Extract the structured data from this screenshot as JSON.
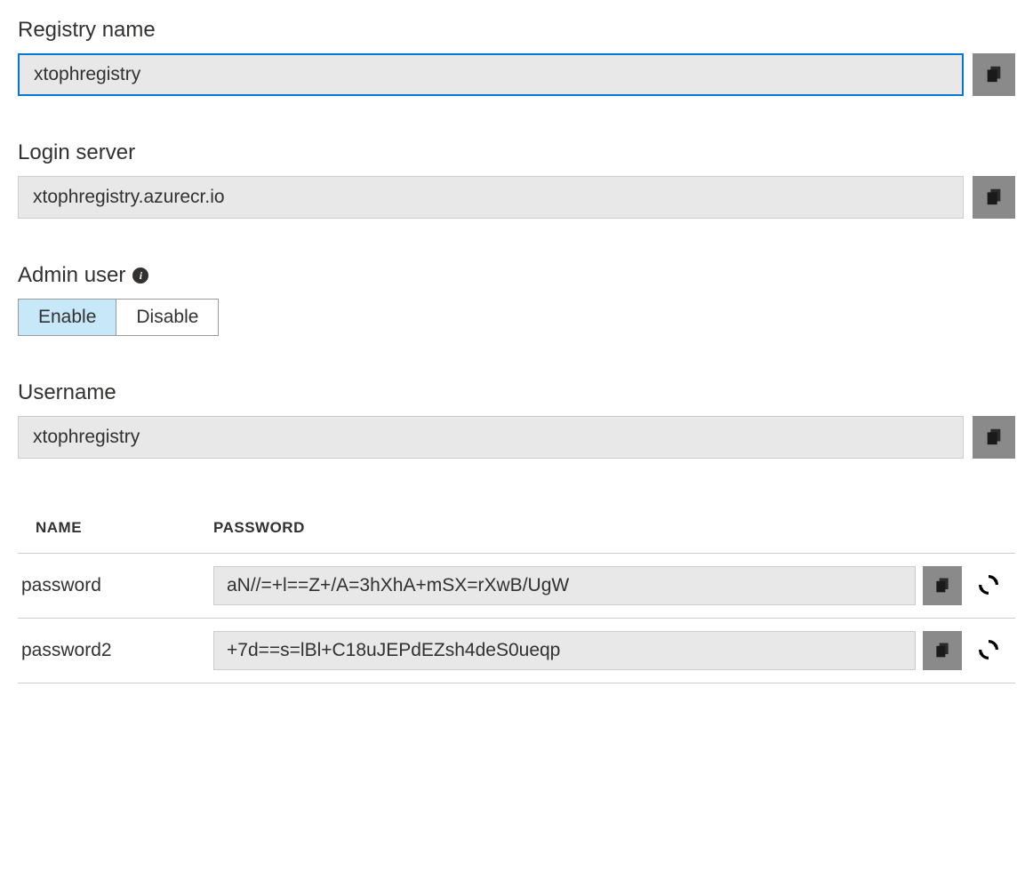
{
  "registry_name": {
    "label": "Registry name",
    "value": "xtophregistry"
  },
  "login_server": {
    "label": "Login server",
    "value": "xtophregistry.azurecr.io"
  },
  "admin_user": {
    "label": "Admin user",
    "enable_label": "Enable",
    "disable_label": "Disable",
    "active": "enable"
  },
  "username": {
    "label": "Username",
    "value": "xtophregistry"
  },
  "password_table": {
    "headers": {
      "name": "NAME",
      "password": "PASSWORD"
    },
    "rows": [
      {
        "name": "password",
        "value": "aN//=+l==Z+/A=3hXhA+mSX=rXwB/UgW"
      },
      {
        "name": "password2",
        "value": "+7d==s=lBl+C18uJEPdEZsh4deS0ueqp"
      }
    ]
  }
}
